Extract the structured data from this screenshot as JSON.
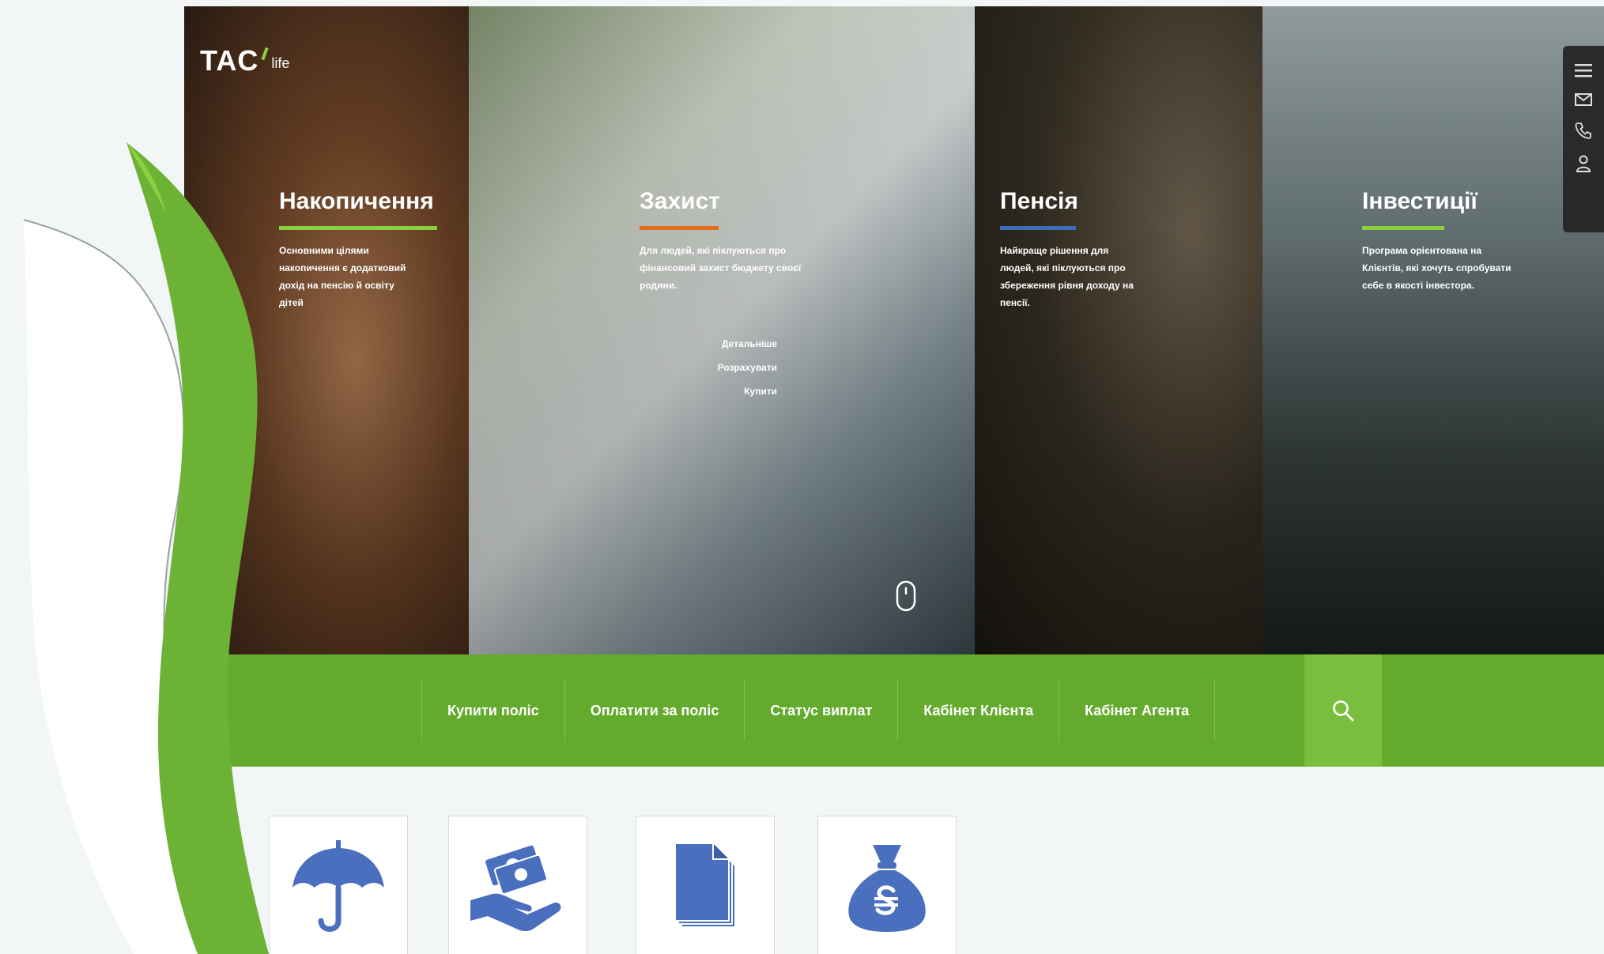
{
  "logo": {
    "main": "TAC",
    "sub": "life"
  },
  "panels": [
    {
      "title": "Накопичення",
      "description": "Основними цілями накопичення є додатковий дохід на пенсію й освіту дітей",
      "accent": "#8bd041"
    },
    {
      "title": "Захист",
      "description": "Для людей, які піклуються про фінансовий захист бюджету своєї родини.",
      "accent": "#e26f1f",
      "links": [
        "Детальніше",
        "Розрахувати",
        "Купити"
      ]
    },
    {
      "title": "Пенсія",
      "description": "Найкраще рішення для людей, які піклуються про збереження рівня доходу на пенсії.",
      "accent": "#3d6fb8"
    },
    {
      "title": "Інвестиції",
      "description": "Програма орієнтована на Клієнтів, які хочуть спробувати себе в якості інвестора.",
      "accent": "#8bd041"
    }
  ],
  "side_tools": [
    "menu-icon",
    "mail-icon",
    "phone-icon",
    "user-icon"
  ],
  "nav": {
    "items": [
      "Купити поліс",
      "Оплатити за поліс",
      "Статус виплат",
      "Кабінет Клієнта",
      "Кабінет Агента"
    ],
    "search_icon": "search-icon",
    "color": "#64ab2d"
  },
  "cards": [
    "umbrella-icon",
    "money-hand-icon",
    "documents-icon",
    "money-bag-icon"
  ],
  "icon_color": "#4a6fbf"
}
